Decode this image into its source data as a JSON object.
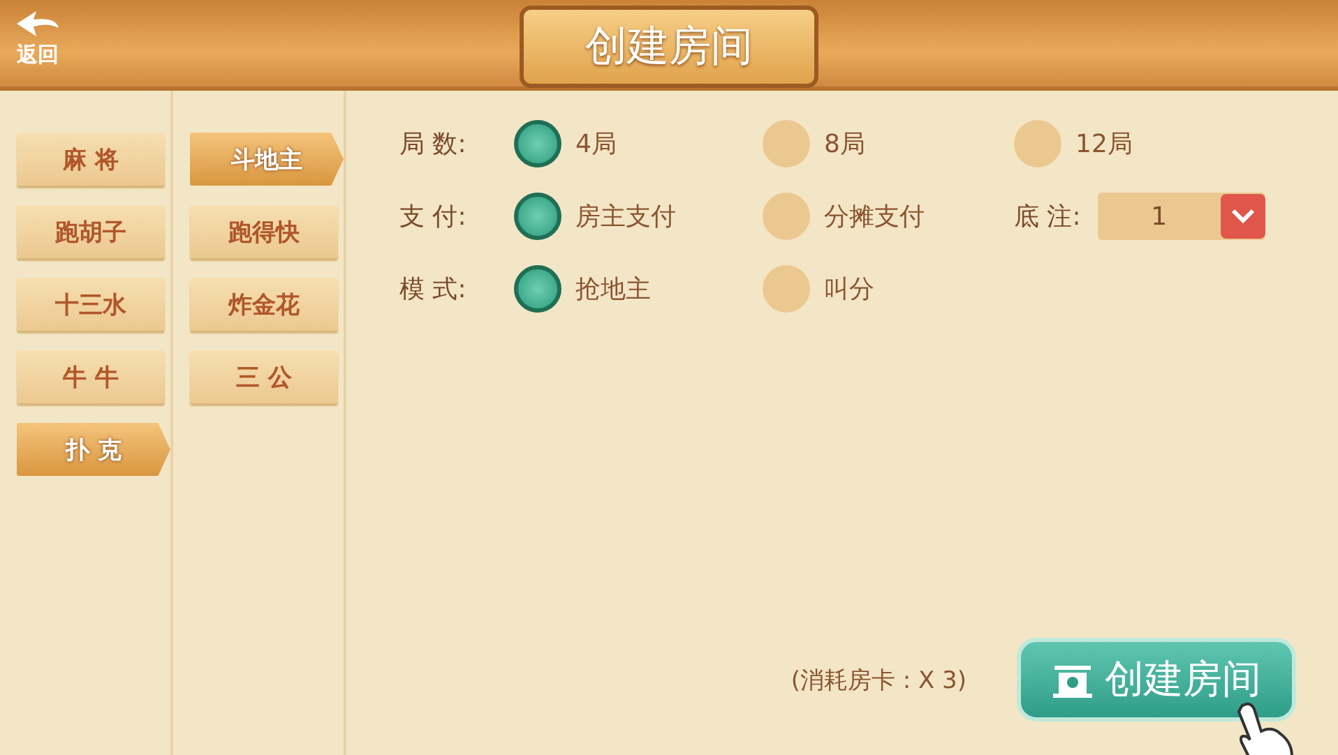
{
  "header": {
    "back_label": "返回",
    "title": "创建房间"
  },
  "categories": [
    {
      "label": "麻 将",
      "selected": false
    },
    {
      "label": "跑胡子",
      "selected": false
    },
    {
      "label": "十三水",
      "selected": false
    },
    {
      "label": "牛 牛",
      "selected": false
    },
    {
      "label": "扑 克",
      "selected": true
    }
  ],
  "games": [
    {
      "label": "斗地主",
      "selected": true
    },
    {
      "label": "跑得快",
      "selected": false
    },
    {
      "label": "炸金花",
      "selected": false
    },
    {
      "label": "三 公",
      "selected": false
    }
  ],
  "options": [
    {
      "label": "局 数:",
      "choices": [
        {
          "label": "4局",
          "selected": true
        },
        {
          "label": "8局",
          "selected": false
        },
        {
          "label": "12局",
          "selected": false
        }
      ]
    },
    {
      "label": "支 付:",
      "choices": [
        {
          "label": "房主支付",
          "selected": true
        },
        {
          "label": "分摊支付",
          "selected": false
        }
      ],
      "extra": {
        "label": "底 注:",
        "value": "1"
      }
    },
    {
      "label": "模 式:",
      "choices": [
        {
          "label": "抢地主",
          "selected": true
        },
        {
          "label": "叫分",
          "selected": false
        }
      ]
    }
  ],
  "footer": {
    "cost": "(消耗房卡 : X 3)",
    "button": "创建房间"
  }
}
